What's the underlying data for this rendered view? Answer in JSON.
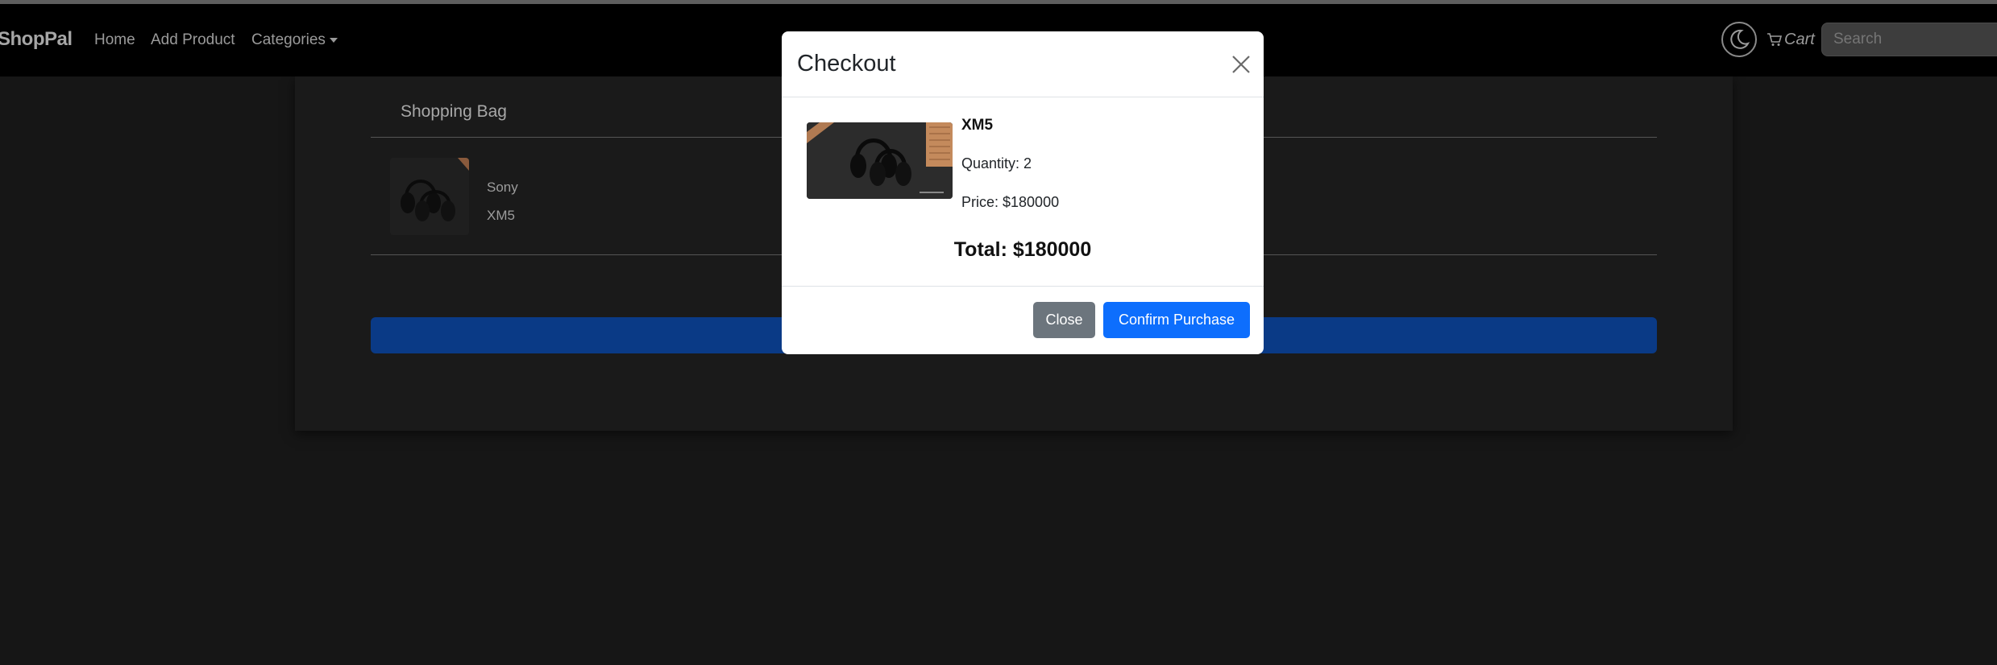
{
  "navbar": {
    "brand": "ShopPal",
    "links": [
      "Home",
      "Add Product",
      "Categories"
    ],
    "cart_label": "Cart",
    "search_placeholder": "Search",
    "icons": {
      "theme": "moon-icon",
      "cart": "cart-icon",
      "categories": "caret-down-icon"
    }
  },
  "bag": {
    "title": "Shopping Bag",
    "items": [
      {
        "brand": "Sony",
        "model": "XM5"
      }
    ]
  },
  "modal": {
    "title": "Checkout",
    "product_name": "XM5",
    "quantity_text": "Quantity: 2",
    "price_text": "Price: $180000",
    "total_text": "Total: $180000",
    "close_label": "Close",
    "confirm_label": "Confirm Purchase"
  },
  "colors": {
    "background": "#161616",
    "navbar": "#000000",
    "primary": "#0d6efd",
    "secondary": "#6c757d",
    "checkout_bar": "#0a3a86"
  }
}
